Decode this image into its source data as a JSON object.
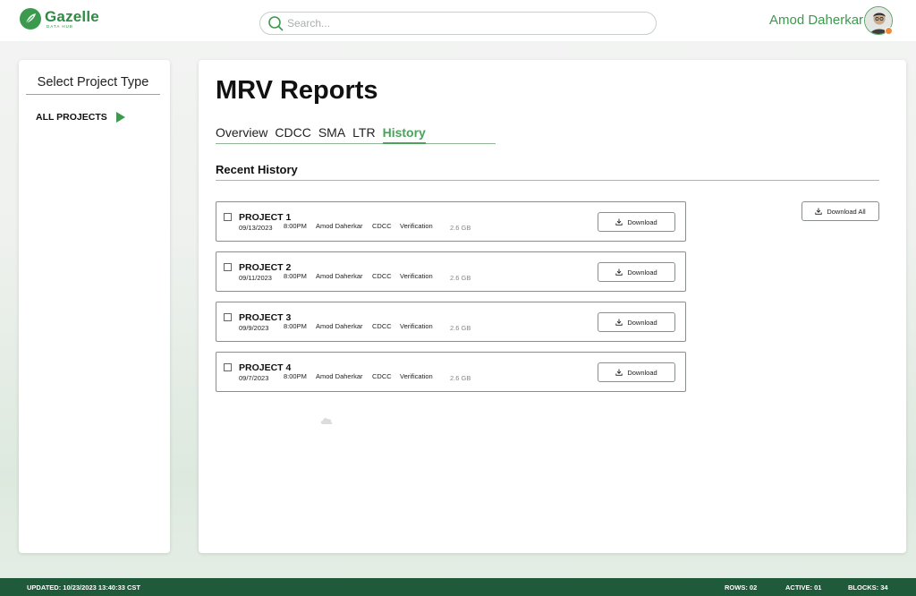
{
  "header": {
    "logo_name": "Gazelle",
    "logo_sub": "DATA HUB",
    "search_placeholder": "Search...",
    "user_name": "Amod Daherkar"
  },
  "sidebar": {
    "title": "Select Project Type",
    "items": [
      {
        "label": "ALL PROJECTS",
        "icon": "play-icon"
      }
    ]
  },
  "main": {
    "title": "MRV Reports",
    "tabs": [
      {
        "label": "Overview",
        "active": false
      },
      {
        "label": "CDCC",
        "active": false
      },
      {
        "label": "SMA",
        "active": false
      },
      {
        "label": "LTR",
        "active": false
      },
      {
        "label": "History",
        "active": true
      }
    ],
    "section_title": "Recent History",
    "download_all_label": "Download All",
    "rows": [
      {
        "name": "PROJECT 1",
        "date": "09/13/2023",
        "time": "8:00PM",
        "user": "Amod Daherkar",
        "type": "CDCC",
        "stage": "Verification",
        "size": "2.6 GB",
        "button": "Download"
      },
      {
        "name": "PROJECT 2",
        "date": "09/11/2023",
        "time": "8:00PM",
        "user": "Amod Daherkar",
        "type": "CDCC",
        "stage": "Verification",
        "size": "2.6 GB",
        "button": "Download"
      },
      {
        "name": "PROJECT 3",
        "date": "09/9/2023",
        "time": "8:00PM",
        "user": "Amod Daherkar",
        "type": "CDCC",
        "stage": "Verification",
        "size": "2.6 GB",
        "button": "Download"
      },
      {
        "name": "PROJECT 4",
        "date": "09/7/2023",
        "time": "8:00PM",
        "user": "Amod Daherkar",
        "type": "CDCC",
        "stage": "Verification",
        "size": "2.6 GB",
        "button": "Download"
      }
    ]
  },
  "footer": {
    "updated": "UPDATED: 10/23/2023 13:40:33 CST",
    "rows": "ROWS: 02",
    "active": "ACTIVE: 01",
    "blocks": "BLOCKS: 34"
  },
  "colors": {
    "brand_green": "#3c9a4e",
    "footer_green": "#1f5a3a",
    "active_tab": "#4aa35b"
  }
}
